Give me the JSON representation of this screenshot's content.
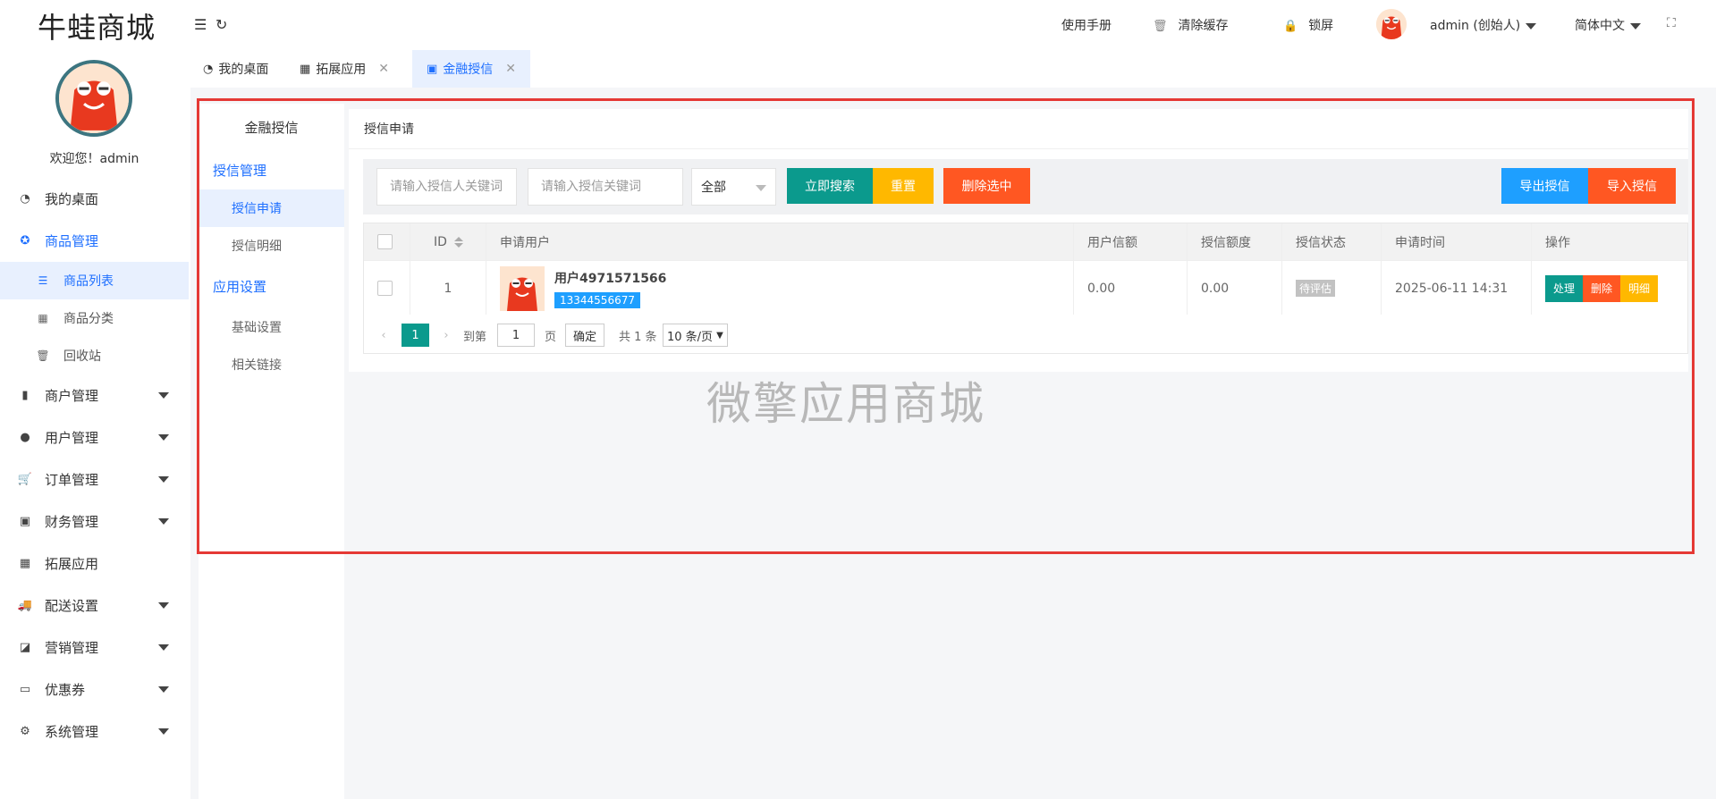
{
  "app": {
    "logo": "牛蛙商城",
    "welcome": "欢迎您！admin"
  },
  "header": {
    "manual": "使用手册",
    "clear_cache": "清除缓存",
    "lock": "锁屏",
    "user": "admin (创始人)",
    "language": "简体中文"
  },
  "tabs": [
    {
      "label": "我的桌面",
      "icon": "dashboard-icon"
    },
    {
      "label": "拓展应用",
      "icon": "grid-icon"
    },
    {
      "label": "金融授信",
      "icon": "finance-icon"
    }
  ],
  "sidebar": {
    "items": [
      {
        "label": "我的桌面",
        "icon": "dashboard-icon"
      },
      {
        "label": "商品管理",
        "icon": "goods-icon"
      },
      {
        "label": "商品列表",
        "icon": "list-icon"
      },
      {
        "label": "商品分类",
        "icon": "grid-icon"
      },
      {
        "label": "回收站",
        "icon": "trash-icon"
      },
      {
        "label": "商户管理",
        "icon": "building-icon"
      },
      {
        "label": "用户管理",
        "icon": "user-icon"
      },
      {
        "label": "订单管理",
        "icon": "cart-icon"
      },
      {
        "label": "财务管理",
        "icon": "money-icon"
      },
      {
        "label": "拓展应用",
        "icon": "grid-icon"
      },
      {
        "label": "配送设置",
        "icon": "truck-icon"
      },
      {
        "label": "营销管理",
        "icon": "marketing-icon"
      },
      {
        "label": "优惠券",
        "icon": "coupon-icon"
      },
      {
        "label": "系统管理",
        "icon": "gear-icon"
      }
    ]
  },
  "subnav": {
    "title": "金融授信",
    "group1": "授信管理",
    "item1": "授信申请",
    "item2": "授信明细",
    "group2": "应用设置",
    "item3": "基础设置",
    "item4": "相关链接"
  },
  "panel": {
    "title": "授信申请",
    "search_user_placeholder": "请输入授信人关键词",
    "search_credit_placeholder": "请输入授信关键词",
    "status_select": "全部",
    "btn_search": "立即搜索",
    "btn_reset": "重置",
    "btn_delete": "删除选中",
    "btn_export": "导出授信",
    "btn_import": "导入授信"
  },
  "table": {
    "columns": [
      "ID",
      "申请用户",
      "用户信额",
      "授信额度",
      "授信状态",
      "申请时间",
      "操作"
    ],
    "rows": [
      {
        "id": "1",
        "user_name": "用户4971571566",
        "phone": "13344556677",
        "user_credit": "0.00",
        "credit_limit": "0.00",
        "status": "待评估",
        "time": "2025-06-11 14:31",
        "op_process": "处理",
        "op_delete": "删除",
        "op_detail": "明细"
      }
    ]
  },
  "pagination": {
    "current": "1",
    "goto": "到第",
    "page_value": "1",
    "page_unit": "页",
    "confirm": "确定",
    "total": "共 1 条",
    "per_page": "10 条/页"
  },
  "watermark": "微擎应用商城",
  "colors": {
    "accent": "#1e6fff",
    "teal": "#0b9a8d",
    "orange": "#ff5722",
    "yellow": "#ffb800",
    "blue": "#1e9fff",
    "highlight": "#e53935"
  }
}
